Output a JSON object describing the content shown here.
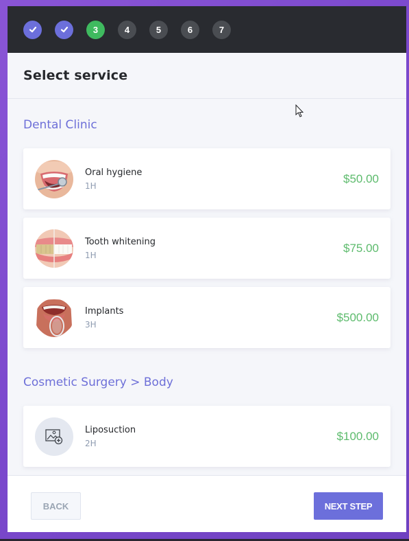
{
  "steps": [
    {
      "label": "✓",
      "state": "done",
      "icon": "check-icon"
    },
    {
      "label": "✓",
      "state": "done",
      "icon": "check-icon"
    },
    {
      "label": "3",
      "state": "active"
    },
    {
      "label": "4",
      "state": "todo"
    },
    {
      "label": "5",
      "state": "todo"
    },
    {
      "label": "6",
      "state": "todo"
    },
    {
      "label": "7",
      "state": "todo"
    }
  ],
  "header": {
    "title": "Select service"
  },
  "categories": [
    {
      "title": "Dental Clinic",
      "services": [
        {
          "name": "Oral hygiene",
          "duration": "1H",
          "price": "$50.00",
          "image": "oral-hygiene-photo"
        },
        {
          "name": "Tooth whitening",
          "duration": "1H",
          "price": "$75.00",
          "image": "tooth-whitening-photo"
        },
        {
          "name": "Implants",
          "duration": "3H",
          "price": "$500.00",
          "image": "implants-photo"
        }
      ]
    },
    {
      "title": "Cosmetic Surgery > Body",
      "services": [
        {
          "name": "Liposuction",
          "duration": "2H",
          "price": "$100.00",
          "image": "image-placeholder-icon"
        }
      ]
    }
  ],
  "footer": {
    "back_label": "BACK",
    "next_label": "NEXT STEP"
  },
  "colors": {
    "accent": "#6c6fdb",
    "active_step": "#3fba5f",
    "pending_step": "#4a4d52",
    "price": "#5dbb6d",
    "category_title": "#6d6fd8",
    "top_bar": "#292b30"
  }
}
